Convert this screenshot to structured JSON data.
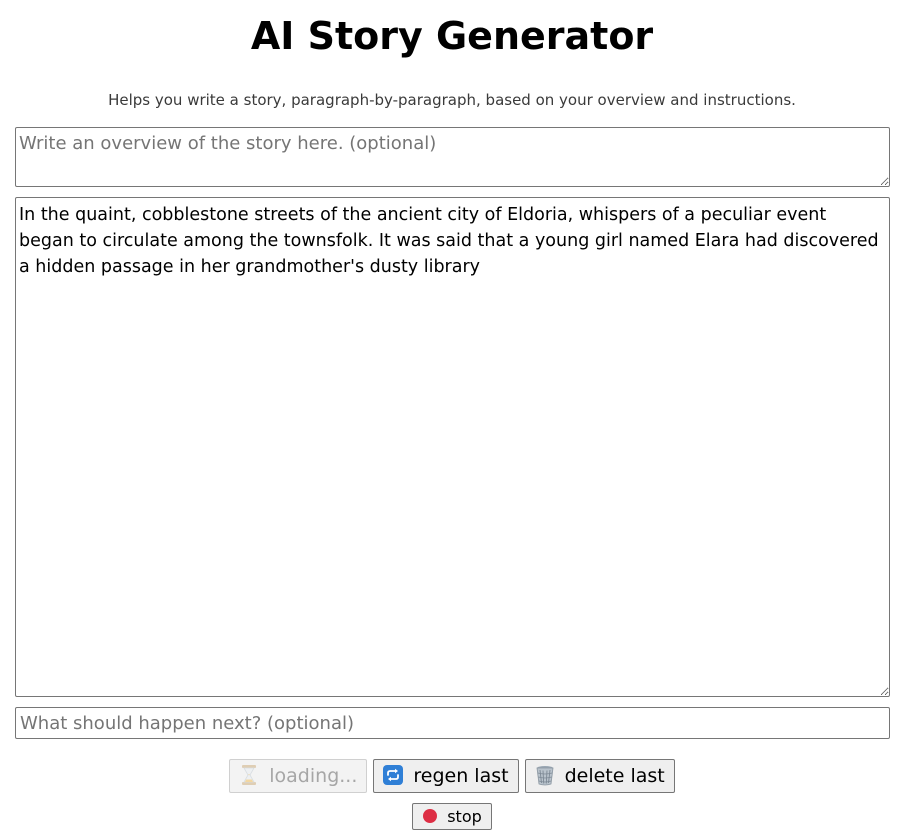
{
  "header": {
    "title": "AI Story Generator",
    "subtitle": "Helps you write a story, paragraph-by-paragraph, based on your overview and instructions."
  },
  "overview": {
    "placeholder": "Write an overview of the story here. (optional)",
    "value": ""
  },
  "story": {
    "value": "In the quaint, cobblestone streets of the ancient city of Eldoria, whispers of a peculiar event began to circulate among the townsfolk. It was said that a young girl named Elara had discovered a hidden passage in her grandmother's dusty library"
  },
  "next": {
    "placeholder": "What should happen next? (optional)",
    "value": ""
  },
  "buttons": {
    "loading_label": "loading...",
    "regen_label": "regen last",
    "delete_label": "delete last",
    "stop_label": "stop"
  },
  "icons": {
    "loading": "hourglass-icon",
    "regen": "repeat-icon",
    "delete": "wastebasket-icon",
    "stop": "red-circle-icon"
  },
  "colors": {
    "regen_icon": "#2f7fd6",
    "stop_icon": "#dd2e44",
    "hourglass": "#f4b740"
  }
}
